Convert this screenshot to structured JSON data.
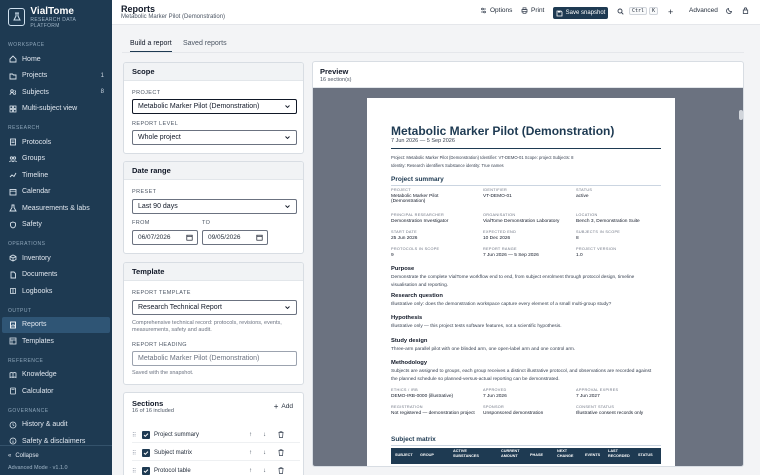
{
  "brand": {
    "name": "VialTome",
    "tagline": "RESEARCH DATA PLATFORM"
  },
  "sidebar": {
    "sections": [
      {
        "label": "WORKSPACE",
        "items": [
          {
            "label": "Home",
            "icon": "home-icon"
          },
          {
            "label": "Projects",
            "icon": "folder-icon",
            "count": "1"
          },
          {
            "label": "Subjects",
            "icon": "users-icon",
            "count": "8"
          },
          {
            "label": "Multi-subject view",
            "icon": "grid-icon"
          }
        ]
      },
      {
        "label": "RESEARCH",
        "items": [
          {
            "label": "Protocols",
            "icon": "protocol-icon"
          },
          {
            "label": "Groups",
            "icon": "groups-icon"
          },
          {
            "label": "Timeline",
            "icon": "timeline-icon"
          },
          {
            "label": "Calendar",
            "icon": "calendar-icon"
          },
          {
            "label": "Measurements & labs",
            "icon": "flask-icon"
          },
          {
            "label": "Safety",
            "icon": "shield-icon"
          }
        ]
      },
      {
        "label": "OPERATIONS",
        "items": [
          {
            "label": "Inventory",
            "icon": "box-icon"
          },
          {
            "label": "Documents",
            "icon": "document-icon"
          },
          {
            "label": "Logbooks",
            "icon": "book-icon"
          }
        ]
      },
      {
        "label": "OUTPUT",
        "items": [
          {
            "label": "Reports",
            "icon": "report-icon",
            "active": true
          },
          {
            "label": "Templates",
            "icon": "template-icon"
          }
        ]
      },
      {
        "label": "REFERENCE",
        "items": [
          {
            "label": "Knowledge",
            "icon": "knowledge-icon"
          },
          {
            "label": "Calculator",
            "icon": "calculator-icon"
          }
        ]
      },
      {
        "label": "GOVERNANCE",
        "items": [
          {
            "label": "History & audit",
            "icon": "history-icon"
          },
          {
            "label": "Safety & disclaimers",
            "icon": "info-icon"
          }
        ]
      }
    ],
    "collapse_label": "Collapse",
    "mode_label": "Advanced Mode · v1.1.0"
  },
  "header": {
    "title": "Reports",
    "subtitle": "Metabolic Marker Pilot (Demonstration)",
    "options_label": "Options",
    "print_label": "Print",
    "save_label": "Save snapshot",
    "kbd_ctrl": "Ctrl",
    "kbd_k": "K",
    "advanced_label": "Advanced"
  },
  "tabs": [
    {
      "label": "Build a report",
      "active": true
    },
    {
      "label": "Saved reports",
      "active": false
    }
  ],
  "scope": {
    "heading": "Scope",
    "project_label": "PROJECT",
    "project_value": "Metabolic Marker Pilot (Demonstration)",
    "level_label": "REPORT LEVEL",
    "level_value": "Whole project"
  },
  "date_range": {
    "heading": "Date range",
    "preset_label": "PRESET",
    "preset_value": "Last 90 days",
    "from_label": "FROM",
    "from_value": "06/07/2026",
    "to_label": "TO",
    "to_value": "09/05/2026"
  },
  "template": {
    "heading": "Template",
    "template_label": "REPORT TEMPLATE",
    "template_value": "Research Technical Report",
    "template_hint": "Comprehensive technical record: protocols, revisions, events, measurements, safety and audit.",
    "heading_label": "REPORT HEADING",
    "heading_placeholder": "Metabolic Marker Pilot (Demonstration)",
    "heading_hint": "Saved with the snapshot."
  },
  "sections": {
    "heading": "Sections",
    "count_text": "16 of 16 included",
    "add_label": "Add",
    "rows": [
      {
        "label": "Project summary"
      },
      {
        "label": "Subject matrix"
      },
      {
        "label": "Protocol table"
      }
    ]
  },
  "preview": {
    "heading": "Preview",
    "count_text": "16 section(s)",
    "doc": {
      "title": "Metabolic Marker Pilot (Demonstration)",
      "dates": "7 Jun 2026 — 5 Sep 2026",
      "meta_line1": "Project: Metabolic Marker Pilot (Demonstration)     Identifier: VT-DEMO-01     Scope: project     Subjects: 8",
      "meta_line2": "Identity: Research identifiers     Substance identity: True names",
      "summary_heading": "Project summary",
      "kv": [
        {
          "k": "PROJECT",
          "v": "Metabolic Marker Pilot (Demonstration)"
        },
        {
          "k": "IDENTIFIER",
          "v": "VT-DEMO-01"
        },
        {
          "k": "STATUS",
          "v": "active"
        },
        {
          "k": "PRINCIPAL RESEARCHER",
          "v": "Demonstration Investigator"
        },
        {
          "k": "ORGANISATION",
          "v": "VialTome Demonstration Laboratory"
        },
        {
          "k": "LOCATION",
          "v": "Bench 3, Demonstration Suite"
        },
        {
          "k": "START DATE",
          "v": "25 Jun 2026"
        },
        {
          "k": "EXPECTED END",
          "v": "10 Dec 2026"
        },
        {
          "k": "SUBJECTS IN SCOPE",
          "v": "8"
        },
        {
          "k": "PROTOCOLS IN SCOPE",
          "v": "9"
        },
        {
          "k": "REPORT RANGE",
          "v": "7 Jun 2026 — 5 Sep 2026"
        },
        {
          "k": "PROJECT VERSION",
          "v": "1.0"
        }
      ],
      "purpose_h": "Purpose",
      "purpose_t": "Demonstrate the complete VialTome workflow end to end, from subject enrolment through protocol design, timeline visualisation and reporting.",
      "question_h": "Research question",
      "question_t": "Illustrative only: does the demonstration workspace capture every element of a small multi-group study?",
      "hypothesis_h": "Hypothesis",
      "hypothesis_t": "Illustrative only — this project tests software features, not a scientific hypothesis.",
      "design_h": "Study design",
      "design_t": "Three-arm parallel pilot with one blinded arm, one open-label arm and one control arm.",
      "method_h": "Methodology",
      "method_t": "Subjects are assigned to groups, each group receives a distinct illustrative protocol, and observations are recorded against the planned schedule so planned-versus-actual reporting can be demonstrated.",
      "kv2": [
        {
          "k": "ETHICS / IRB",
          "v": "DEMO-IRB-0000 (illustrative)"
        },
        {
          "k": "APPROVED",
          "v": "7 Jun 2026"
        },
        {
          "k": "APPROVAL EXPIRES",
          "v": "7 Jun 2027"
        },
        {
          "k": "REGISTRATION",
          "v": "Not registered — demonstration project"
        },
        {
          "k": "SPONSOR",
          "v": "Unsponsored demonstration"
        },
        {
          "k": "CONSENT STATUS",
          "v": "Illustrative consent records only"
        }
      ],
      "matrix_h": "Subject matrix",
      "matrix_cols": [
        "SUBJECT",
        "GROUP",
        "ACTIVE SUBSTANCES",
        "CURRENT AMOUNT",
        "PHASE",
        "NEXT CHANGE",
        "EVENTS",
        "LAST RECORDED",
        "STATUS"
      ]
    }
  },
  "colors": {
    "sidebar": "#1e3a52",
    "accent": "#1e3a52",
    "preview_bg": "#6b7280"
  }
}
